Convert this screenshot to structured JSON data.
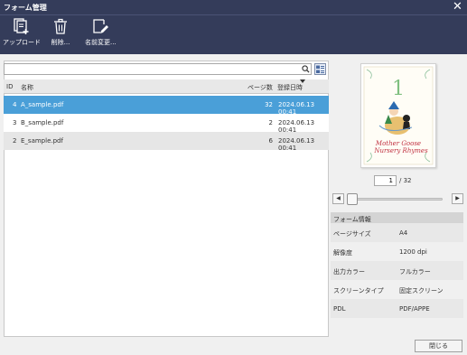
{
  "window": {
    "title": "フォーム管理"
  },
  "toolbar": {
    "upload_label": "アップロード",
    "delete_label": "削除...",
    "rename_label": "名前変更..."
  },
  "search": {
    "value": ""
  },
  "table": {
    "headers": {
      "id": "ID",
      "name": "名称",
      "pages": "ページ数",
      "date": "登録日時"
    },
    "rows": [
      {
        "id": "4",
        "name": "A_sample.pdf",
        "pages": "32",
        "date": "2024.06.13 00:41"
      },
      {
        "id": "3",
        "name": "B_sample.pdf",
        "pages": "2",
        "date": "2024.06.13 00:41"
      },
      {
        "id": "2",
        "name": "E_sample.pdf",
        "pages": "6",
        "date": "2024.06.13 00:41"
      }
    ]
  },
  "preview": {
    "page_number": "1",
    "title_line1": "Mother Goose",
    "title_line2": "Nursery Rhymes"
  },
  "pager": {
    "current": "1",
    "total": "/ 32"
  },
  "form_info": {
    "header": "フォーム情報",
    "rows": [
      {
        "key": "ページサイズ",
        "value": "A4"
      },
      {
        "key": "解像度",
        "value": "1200 dpi"
      },
      {
        "key": "出力カラー",
        "value": "フルカラー"
      },
      {
        "key": "スクリーンタイプ",
        "value": "固定スクリーン"
      },
      {
        "key": "PDL",
        "value": "PDF/APPE"
      }
    ]
  },
  "footer": {
    "close_label": "閉じる"
  },
  "colors": {
    "titlebar": "#343c5a",
    "selection": "#4a9fd8"
  }
}
